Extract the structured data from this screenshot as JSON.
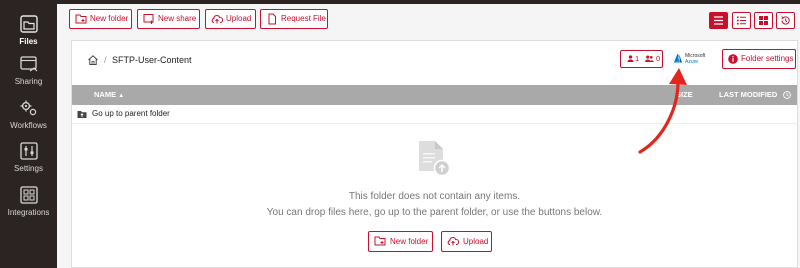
{
  "sidebar": {
    "items": [
      {
        "label": "Files",
        "icon": "files-icon",
        "active": true
      },
      {
        "label": "Sharing",
        "icon": "sharing-icon"
      },
      {
        "label": "Workflows",
        "icon": "workflows-icon"
      },
      {
        "label": "Settings",
        "icon": "settings-icon"
      },
      {
        "label": "Integrations",
        "icon": "integrations-icon"
      }
    ]
  },
  "toolbar": {
    "new_folder": "New folder",
    "new_share": "New share",
    "upload": "Upload",
    "request_file": "Request File"
  },
  "view_buttons": [
    "list-view-icon",
    "compact-list-icon",
    "grid-view-icon",
    "history-icon"
  ],
  "breadcrumb": {
    "path": "SFTP-User-Content",
    "separator": "/"
  },
  "badges": {
    "users": "1",
    "groups": "0"
  },
  "azure": {
    "line1": "Microsoft",
    "line2": "Azure"
  },
  "folder_settings": "Folder settings",
  "table": {
    "headers": {
      "name": "NAME",
      "size": "SIZE",
      "modified": "LAST MODIFIED"
    },
    "sort_arrow": "▲"
  },
  "up_row": "Go up to parent folder",
  "empty": {
    "line1": "This folder does not contain any items.",
    "line2": "You can drop files here, go up to the parent folder, or use the buttons below.",
    "new_folder": "New folder",
    "upload": "Upload"
  },
  "colors": {
    "accent": "#c8102e",
    "sidebar": "#2c2422",
    "header": "#a9a9a9",
    "arrow": "#e0261e"
  }
}
